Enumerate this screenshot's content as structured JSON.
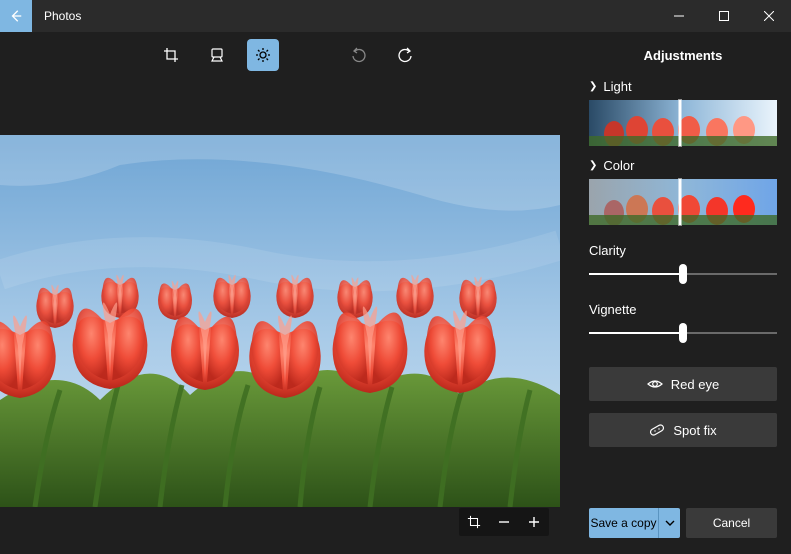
{
  "app": {
    "title": "Photos"
  },
  "panel": {
    "title": "Adjustments",
    "light_label": "Light",
    "color_label": "Color",
    "clarity_label": "Clarity",
    "vignette_label": "Vignette",
    "red_eye_label": "Red eye",
    "spot_fix_label": "Spot fix",
    "clarity_value": 50,
    "vignette_value": 50,
    "light_marker_pct": 48,
    "color_marker_pct": 48
  },
  "footer": {
    "save_label": "Save a copy",
    "cancel_label": "Cancel"
  },
  "colors": {
    "accent": "#7fb7e2",
    "panel_bg": "#1f1f1f",
    "button_bg": "#3a3a3a"
  }
}
